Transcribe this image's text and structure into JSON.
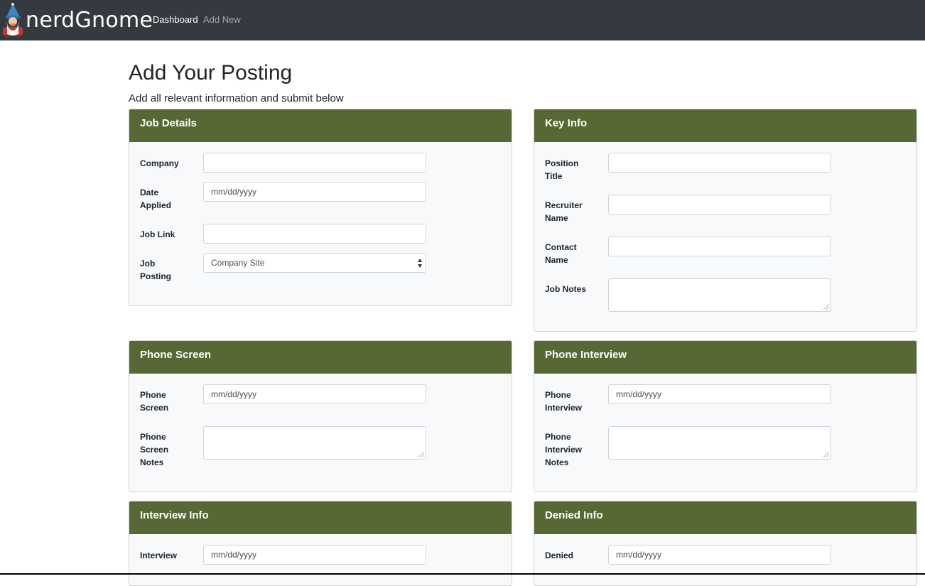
{
  "nav": {
    "brand": "nerdGnome",
    "links": [
      "Dashboard",
      "Add New"
    ]
  },
  "page": {
    "title": "Add Your Posting",
    "subtitle": "Add all relevant information and submit below"
  },
  "cards": {
    "job_details": {
      "title": "Job Details",
      "company": {
        "label": "Company",
        "value": ""
      },
      "date_applied": {
        "label": "Date Applied",
        "value": "mm/dd/yyyy"
      },
      "job_link": {
        "label": "Job Link",
        "value": ""
      },
      "job_posting": {
        "label": "Job Posting",
        "value": "Company Site"
      }
    },
    "key_info": {
      "title": "Key Info",
      "position_title": {
        "label": "Position Title",
        "value": ""
      },
      "recruiter_name": {
        "label": "Recruiter Name",
        "value": ""
      },
      "contact_name": {
        "label": "Contact Name",
        "value": ""
      },
      "job_notes": {
        "label": "Job Notes",
        "value": ""
      }
    },
    "phone_screen": {
      "title": "Phone Screen",
      "date": {
        "label": "Phone Screen",
        "value": "mm/dd/yyyy"
      },
      "notes": {
        "label": "Phone Screen Notes",
        "value": ""
      }
    },
    "phone_interview": {
      "title": "Phone Interview",
      "date": {
        "label": "Phone Interview",
        "value": "mm/dd/yyyy"
      },
      "notes": {
        "label": "Phone Interview Notes",
        "value": ""
      }
    },
    "interview_info": {
      "title": "Interview Info",
      "date": {
        "label": "Interview",
        "value": "mm/dd/yyyy"
      }
    },
    "denied_info": {
      "title": "Denied Info",
      "date": {
        "label": "Denied",
        "value": "mm/dd/yyyy"
      }
    }
  },
  "colors": {
    "navbar": "#343a40",
    "card_header": "#566834",
    "card_body": "#f8f9fa"
  },
  "icons": {
    "brand_logo": "gnome-icon",
    "select_arrows": "updown-arrows-icon",
    "resize_grip": "resize-grip-icon"
  }
}
